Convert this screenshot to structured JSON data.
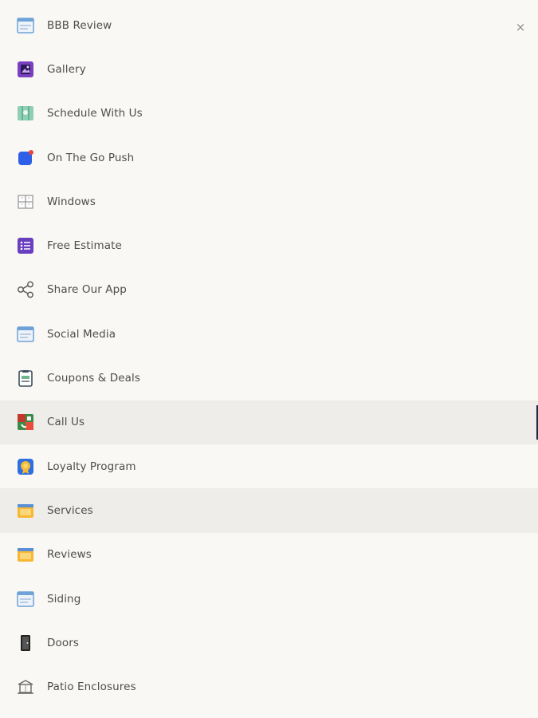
{
  "menu": {
    "close_glyph": "×",
    "items": [
      {
        "label": "BBB Review",
        "icon": "browser-window-icon"
      },
      {
        "label": "Gallery",
        "icon": "gallery-icon"
      },
      {
        "label": "Schedule With Us",
        "icon": "calendar-map-icon"
      },
      {
        "label": "On The Go Push",
        "icon": "push-notification-icon"
      },
      {
        "label": "Windows",
        "icon": "window-grid-icon"
      },
      {
        "label": "Free Estimate",
        "icon": "checklist-icon"
      },
      {
        "label": "Share Our App",
        "icon": "share-icon"
      },
      {
        "label": "Social Media",
        "icon": "browser-window-icon"
      },
      {
        "label": "Coupons & Deals",
        "icon": "coupon-icon"
      },
      {
        "label": "Call Us",
        "icon": "phone-contact-icon"
      },
      {
        "label": "Loyalty Program",
        "icon": "loyalty-badge-icon"
      },
      {
        "label": "Services",
        "icon": "folder-icon"
      },
      {
        "label": "Reviews",
        "icon": "folder-icon"
      },
      {
        "label": "Siding",
        "icon": "browser-window-icon"
      },
      {
        "label": "Doors",
        "icon": "door-icon"
      },
      {
        "label": "Patio Enclosures",
        "icon": "patio-icon"
      }
    ]
  },
  "colors": {
    "background": "#f9f8f4",
    "highlight": "#eeede9",
    "text": "#4d4d4d",
    "active_indicator": "#1f2a44"
  }
}
